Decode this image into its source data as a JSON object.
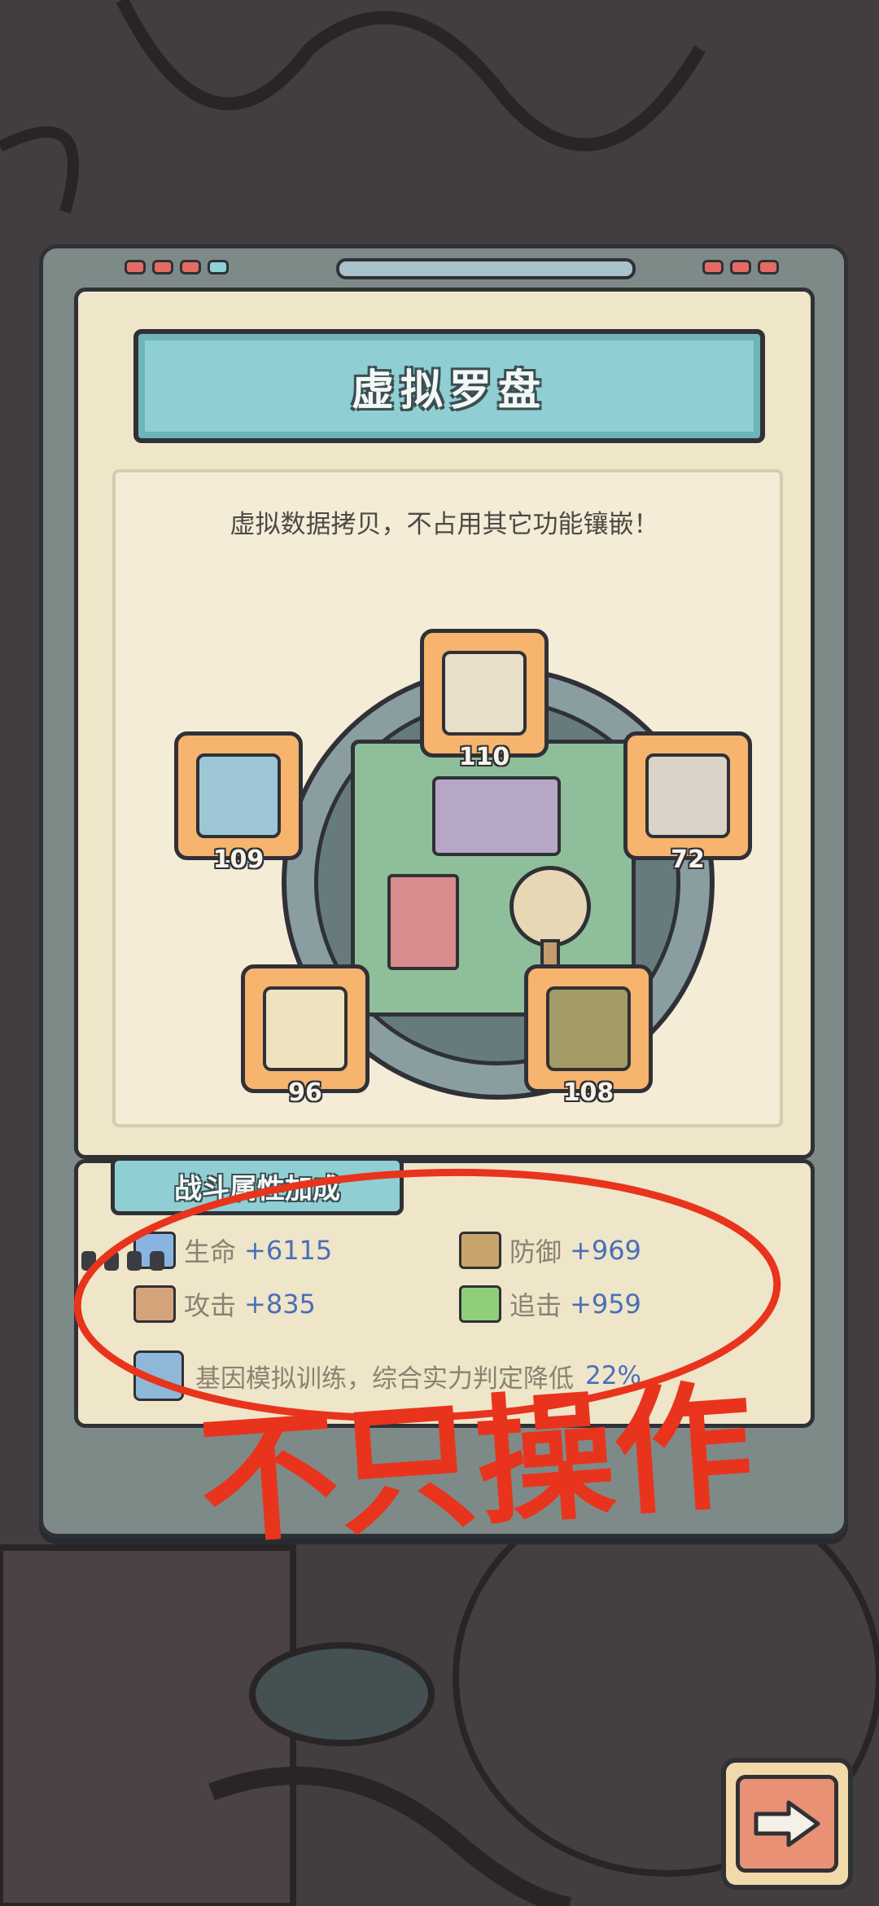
{
  "dialog": {
    "title": "虚拟罗盘",
    "subtitle": "虚拟数据拷贝，不占用其它功能镶嵌！"
  },
  "slots": [
    {
      "name": "document",
      "count": "110",
      "icon": "scroll-document-icon",
      "color": "#e8dfc8"
    },
    {
      "name": "dice-box",
      "count": "109",
      "icon": "rubiks-cube-icon",
      "color": "#9ec7d6"
    },
    {
      "name": "statue",
      "count": "72",
      "icon": "bust-statue-icon",
      "color": "#d9d3c8"
    },
    {
      "name": "scroll",
      "count": "96",
      "icon": "paper-scroll-icon",
      "color": "#efe2bf"
    },
    {
      "name": "artifact",
      "count": "108",
      "icon": "ancient-artifact-icon",
      "color": "#a59b66"
    }
  ],
  "bonus": {
    "title": "战斗属性加成",
    "stats": [
      {
        "label": "生命",
        "value": "+6115",
        "icon": "health-icon"
      },
      {
        "label": "防御",
        "value": "+969",
        "icon": "shield-icon"
      },
      {
        "label": "攻击",
        "value": "+835",
        "icon": "sword-icon"
      },
      {
        "label": "追击",
        "value": "+959",
        "icon": "pursuit-icon"
      }
    ],
    "gene_text": "基因模拟训练，综合实力判定降低",
    "gene_pct": "22%"
  },
  "annotation": {
    "handwritten": "不只操作",
    "color": "#e8341c"
  },
  "colors": {
    "accent": "#8fcfd3",
    "slot": "#f6b46e",
    "value": "#4a6fb8"
  }
}
